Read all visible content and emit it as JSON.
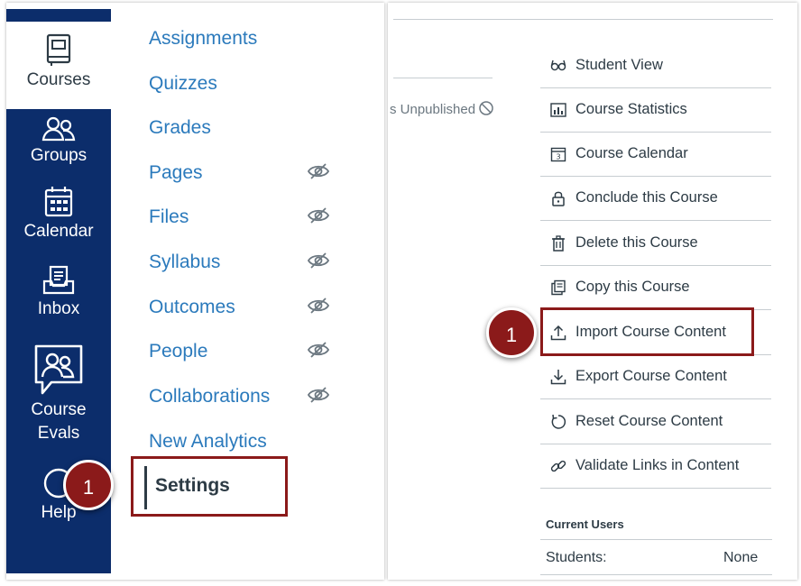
{
  "global_nav": {
    "items": [
      {
        "label": "Courses",
        "icon": "courses-icon"
      },
      {
        "label": "Groups",
        "icon": "groups-icon"
      },
      {
        "label": "Calendar",
        "icon": "calendar-icon"
      },
      {
        "label": "Inbox",
        "icon": "inbox-icon"
      },
      {
        "label_line1": "Course",
        "label_line2": "Evals",
        "icon": "course-evals-icon"
      },
      {
        "label": "Help",
        "icon": "help-icon"
      }
    ]
  },
  "course_nav": {
    "items": [
      {
        "label": "Assignments",
        "hidden": false
      },
      {
        "label": "Quizzes",
        "hidden": false
      },
      {
        "label": "Grades",
        "hidden": false
      },
      {
        "label": "Pages",
        "hidden": true
      },
      {
        "label": "Files",
        "hidden": true
      },
      {
        "label": "Syllabus",
        "hidden": true
      },
      {
        "label": "Outcomes",
        "hidden": true
      },
      {
        "label": "People",
        "hidden": true
      },
      {
        "label": "Collaborations",
        "hidden": true
      },
      {
        "label": "New Analytics",
        "hidden": false
      },
      {
        "label": "Settings",
        "hidden": false,
        "active": true
      }
    ]
  },
  "status": {
    "unpublished": "s Unpublished"
  },
  "sidebar": {
    "items": [
      {
        "label": "Student View",
        "icon": "glasses-icon"
      },
      {
        "label": "Course Statistics",
        "icon": "bar-chart-icon"
      },
      {
        "label": "Course Calendar",
        "icon": "calendar-icon"
      },
      {
        "label": "Conclude this Course",
        "icon": "lock-icon"
      },
      {
        "label": "Delete this Course",
        "icon": "trash-icon"
      },
      {
        "label": "Copy this Course",
        "icon": "copy-icon"
      },
      {
        "label": "Import Course Content",
        "icon": "upload-icon"
      },
      {
        "label": "Export Course Content",
        "icon": "download-icon"
      },
      {
        "label": "Reset Course Content",
        "icon": "reset-icon"
      },
      {
        "label": "Validate Links in Content",
        "icon": "link-icon"
      }
    ]
  },
  "current_users": {
    "heading": "Current Users",
    "rows": [
      {
        "label": "Students:",
        "value": "None"
      }
    ]
  },
  "callouts": {
    "left": "1",
    "right": "1"
  },
  "colors": {
    "nav_bg": "#0c2d6b",
    "link": "#2b7abc",
    "callout": "#8b1a1a",
    "text": "#2d3b45"
  }
}
